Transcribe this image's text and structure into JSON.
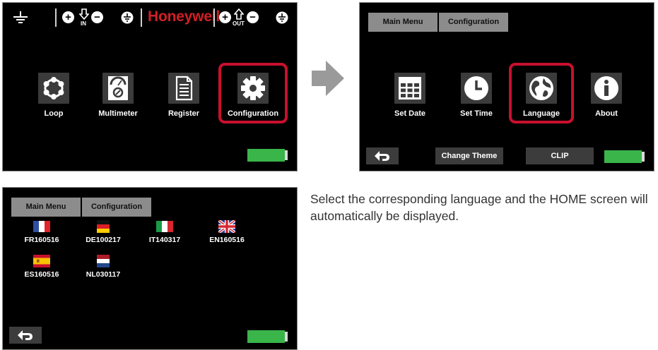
{
  "screen1": {
    "brand": "Honeywell",
    "status": {
      "in_label": "IN",
      "out_label": "OUT"
    },
    "apps": [
      {
        "label": "Loop",
        "icon": "loop-icon"
      },
      {
        "label": "Multimeter",
        "icon": "multimeter-icon"
      },
      {
        "label": "Register",
        "icon": "register-icon"
      },
      {
        "label": "Configuration",
        "icon": "gear-icon"
      }
    ],
    "highlighted": "Configuration"
  },
  "screen2": {
    "tabs": [
      "Main Menu",
      "Configuration"
    ],
    "apps": [
      {
        "label": "Set Date",
        "icon": "calendar-icon"
      },
      {
        "label": "Set Time",
        "icon": "clock-icon"
      },
      {
        "label": "Language",
        "icon": "globe-icon"
      },
      {
        "label": "About",
        "icon": "info-icon"
      }
    ],
    "highlighted": "Language",
    "buttons": {
      "change_theme": "Change Theme",
      "clip": "CLIP"
    }
  },
  "screen3": {
    "tabs": [
      "Main Menu",
      "Configuration"
    ],
    "languages": [
      {
        "label": "FR160516",
        "flag": "france-flag-icon"
      },
      {
        "label": "DE100217",
        "flag": "germany-flag-icon"
      },
      {
        "label": "IT140317",
        "flag": "italy-flag-icon"
      },
      {
        "label": "EN160516",
        "flag": "uk-flag-icon"
      },
      {
        "label": "ES160516",
        "flag": "spain-flag-icon"
      },
      {
        "label": "NL030117",
        "flag": "netherlands-flag-icon"
      }
    ]
  },
  "caption": "Select the corresponding language and the HOME screen will automatically be displayed.",
  "colors": {
    "highlight": "#c8102e",
    "brand": "#d21f25",
    "battery": "#39b54a",
    "tab": "#8c8c8c",
    "arrow": "#9a9a9a"
  }
}
